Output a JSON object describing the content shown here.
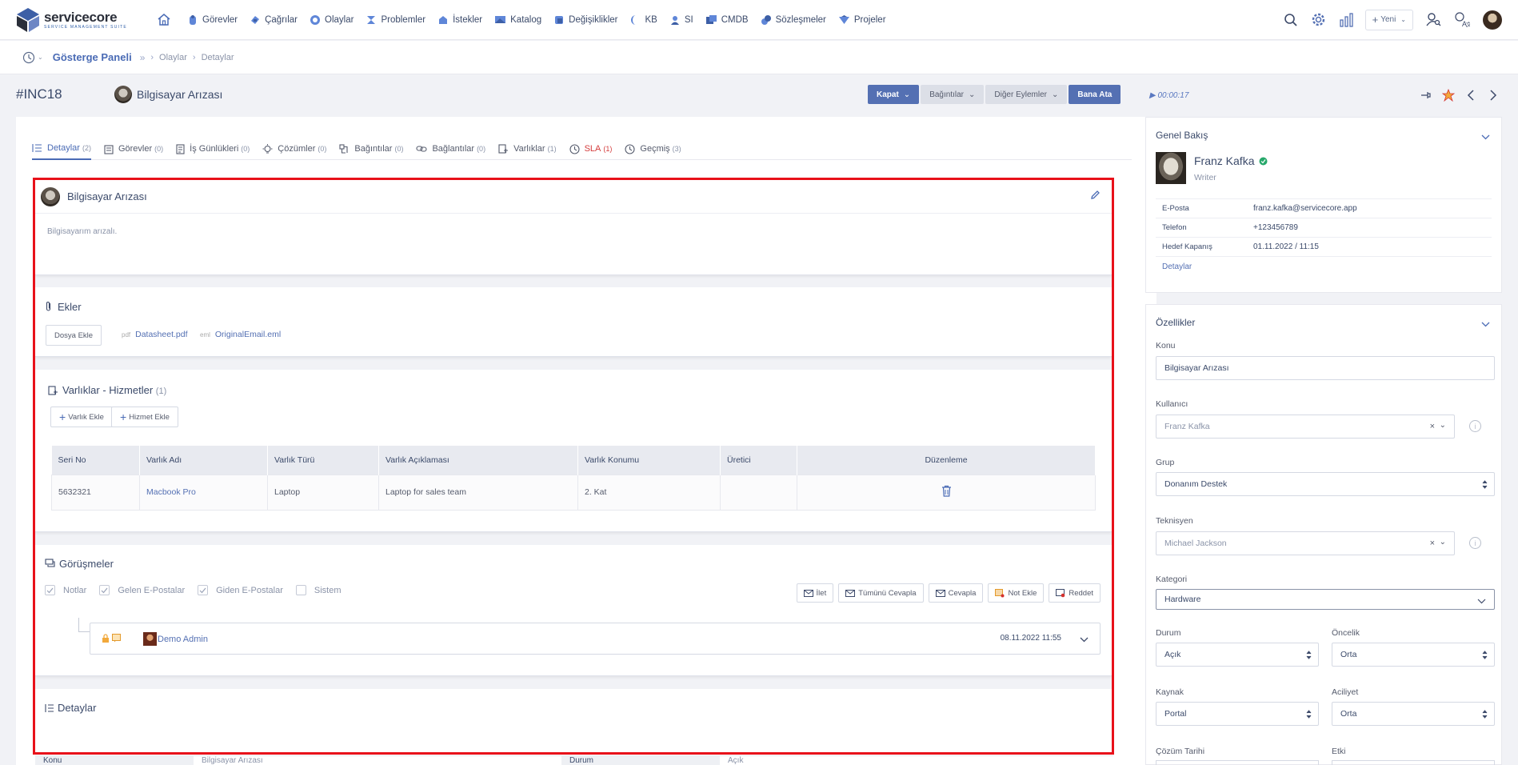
{
  "brand": {
    "title": "servicecore",
    "subtitle": "SERVICE MANAGEMENT SUITE"
  },
  "nav": [
    {
      "label": "Görevler",
      "icon": "task-icon"
    },
    {
      "label": "Çağrılar",
      "icon": "call-icon"
    },
    {
      "label": "Olaylar",
      "icon": "incident-icon"
    },
    {
      "label": "Problemler",
      "icon": "problem-icon"
    },
    {
      "label": "İstekler",
      "icon": "request-icon"
    },
    {
      "label": "Katalog",
      "icon": "catalog-icon"
    },
    {
      "label": "Değişiklikler",
      "icon": "change-icon"
    },
    {
      "label": "KB",
      "icon": "kb-icon"
    },
    {
      "label": "SI",
      "icon": "si-icon"
    },
    {
      "label": "CMDB",
      "icon": "cmdb-icon"
    },
    {
      "label": "Sözleşmeler",
      "icon": "contract-icon"
    },
    {
      "label": "Projeler",
      "icon": "project-icon"
    }
  ],
  "topbar": {
    "new_label": "Yeni"
  },
  "breadcrumb": {
    "home": "Gösterge Paneli",
    "items": [
      "Olaylar",
      "Detaylar"
    ],
    "sep": "›"
  },
  "header": {
    "inc_no": "#INC18",
    "title": "Bilgisayar Arızası",
    "timer": "00:00:17"
  },
  "actions": {
    "close": "Kapat",
    "relations": "Bağıntılar",
    "other": "Diğer Eylemler",
    "assign": "Bana Ata"
  },
  "tabs": [
    {
      "label": "Detaylar",
      "count": "(2)"
    },
    {
      "label": "Görevler",
      "count": "(0)"
    },
    {
      "label": "İş Günlükleri",
      "count": "(0)"
    },
    {
      "label": "Çözümler",
      "count": "(0)"
    },
    {
      "label": "Bağıntılar",
      "count": "(0)"
    },
    {
      "label": "Bağlantılar",
      "count": "(0)"
    },
    {
      "label": "Varlıklar",
      "count": "(1)"
    },
    {
      "label": "SLA",
      "count": "(1)"
    },
    {
      "label": "Geçmiş",
      "count": "(3)"
    }
  ],
  "description": {
    "title": "Bilgisayar Arızası",
    "body": "Bilgisayarım arızalı."
  },
  "attachments": {
    "title": "Ekler",
    "add_label": "Dosya Ekle",
    "files": [
      {
        "ext": "pdf",
        "name": "Datasheet.pdf"
      },
      {
        "ext": "eml",
        "name": "OriginalEmail.eml"
      }
    ]
  },
  "assets": {
    "title": "Varlıklar - Hizmetler",
    "count": "(1)",
    "add_asset": "Varlık Ekle",
    "add_service": "Hizmet Ekle",
    "columns": [
      "Seri No",
      "Varlık Adı",
      "Varlık Türü",
      "Varlık Açıklaması",
      "Varlık Konumu",
      "Üretici",
      "Düzenleme"
    ],
    "rows": [
      {
        "serial": "5632321",
        "name": "Macbook Pro",
        "type": "Laptop",
        "desc": "Laptop for sales team",
        "location": "2. Kat",
        "maker": ""
      }
    ]
  },
  "conversations": {
    "title": "Görüşmeler",
    "filters": [
      "Notlar",
      "Gelen E-Postalar",
      "Giden E-Postalar",
      "Sistem"
    ],
    "buttons": [
      "İlet",
      "Tümünü Cevapla",
      "Cevapla",
      "Not Ekle",
      "Reddet"
    ],
    "entry": {
      "author": "Demo Admin",
      "date": "08.11.2022 11:55"
    }
  },
  "details": {
    "title": "Detaylar",
    "row_labels": [
      "Konu",
      "Durum"
    ],
    "row_values": [
      "Bilgisayar Arızası",
      "Açık"
    ]
  },
  "overview": {
    "title": "Genel Bakış",
    "name": "Franz Kafka",
    "role": "Writer",
    "fields": [
      {
        "k": "E-Posta",
        "v": "franz.kafka@servicecore.app"
      },
      {
        "k": "Telefon",
        "v": "+123456789"
      },
      {
        "k": "Hedef Kapanış",
        "v": "01.11.2022 / 11:15"
      }
    ],
    "details_link": "Detaylar"
  },
  "properties": {
    "title": "Özellikler",
    "subject_label": "Konu",
    "subject": "Bilgisayar Arızası",
    "user_label": "Kullanıcı",
    "user": "Franz Kafka",
    "group_label": "Grup",
    "group": "Donanım Destek",
    "tech_label": "Teknisyen",
    "tech": "Michael Jackson",
    "category_label": "Kategori",
    "category": "Hardware",
    "status_label": "Durum",
    "status": "Açık",
    "priority_label": "Öncelik",
    "priority": "Orta",
    "source_label": "Kaynak",
    "source": "Portal",
    "urgency_label": "Aciliyet",
    "urgency": "Orta",
    "resolve_label": "Çözüm Tarihi",
    "impact_label": "Etki"
  },
  "colors": {
    "accent": "#5470b3",
    "highlight": "#e8111a",
    "sla": "#d43c3c"
  }
}
